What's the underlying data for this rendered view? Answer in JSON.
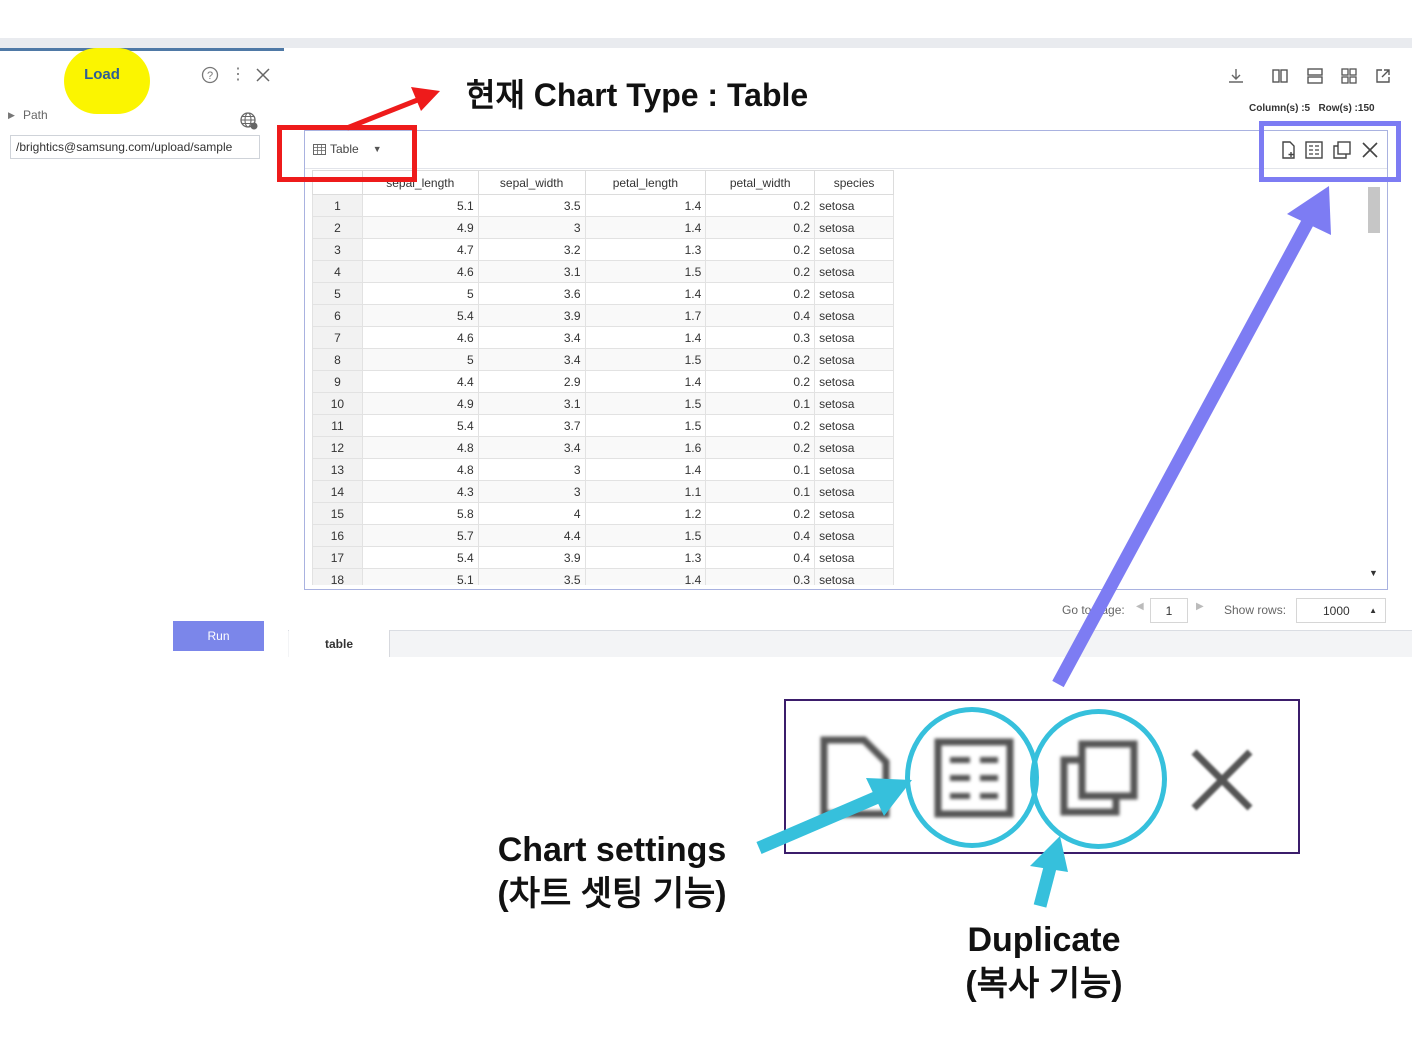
{
  "panel": {
    "title": "Load",
    "path_label": "Path",
    "path_value": "/brightics@samsung.com/upload/sample",
    "run_label": "Run",
    "kebab_symbol": "⋮"
  },
  "header": {
    "columns_info": "Column(s) :5",
    "rows_info": "Row(s) :150"
  },
  "chart": {
    "type_label": "Table"
  },
  "table": {
    "columns": [
      "sepal_length",
      "sepal_width",
      "petal_length",
      "petal_width",
      "species"
    ],
    "rows": [
      [
        "1",
        "5.1",
        "3.5",
        "1.4",
        "0.2",
        "setosa"
      ],
      [
        "2",
        "4.9",
        "3",
        "1.4",
        "0.2",
        "setosa"
      ],
      [
        "3",
        "4.7",
        "3.2",
        "1.3",
        "0.2",
        "setosa"
      ],
      [
        "4",
        "4.6",
        "3.1",
        "1.5",
        "0.2",
        "setosa"
      ],
      [
        "5",
        "5",
        "3.6",
        "1.4",
        "0.2",
        "setosa"
      ],
      [
        "6",
        "5.4",
        "3.9",
        "1.7",
        "0.4",
        "setosa"
      ],
      [
        "7",
        "4.6",
        "3.4",
        "1.4",
        "0.3",
        "setosa"
      ],
      [
        "8",
        "5",
        "3.4",
        "1.5",
        "0.2",
        "setosa"
      ],
      [
        "9",
        "4.4",
        "2.9",
        "1.4",
        "0.2",
        "setosa"
      ],
      [
        "10",
        "4.9",
        "3.1",
        "1.5",
        "0.1",
        "setosa"
      ],
      [
        "11",
        "5.4",
        "3.7",
        "1.5",
        "0.2",
        "setosa"
      ],
      [
        "12",
        "4.8",
        "3.4",
        "1.6",
        "0.2",
        "setosa"
      ],
      [
        "13",
        "4.8",
        "3",
        "1.4",
        "0.1",
        "setosa"
      ],
      [
        "14",
        "4.3",
        "3",
        "1.1",
        "0.1",
        "setosa"
      ],
      [
        "15",
        "5.8",
        "4",
        "1.2",
        "0.2",
        "setosa"
      ],
      [
        "16",
        "5.7",
        "4.4",
        "1.5",
        "0.4",
        "setosa"
      ],
      [
        "17",
        "5.4",
        "3.9",
        "1.3",
        "0.4",
        "setosa"
      ],
      [
        "18",
        "5.1",
        "3.5",
        "1.4",
        "0.3",
        "setosa"
      ]
    ]
  },
  "pager": {
    "go_label": "Go to page:",
    "page_value": "1",
    "rows_label": "Show rows:",
    "rows_value": "1000"
  },
  "tabs": [
    "table"
  ],
  "annotations": {
    "title": "현재 Chart Type : Table",
    "settings_en": "Chart settings",
    "settings_ko": "(차트 셋팅 기능)",
    "duplicate_en": "Duplicate",
    "duplicate_ko": "(복사 기능)"
  },
  "colors": {
    "highlight_yellow": "#fbf500",
    "red_arrow": "#ee1b1b",
    "blue_arrow": "#7d7cf3",
    "cyan_arrow": "#36c0dc",
    "run_button": "#7b86ea"
  }
}
